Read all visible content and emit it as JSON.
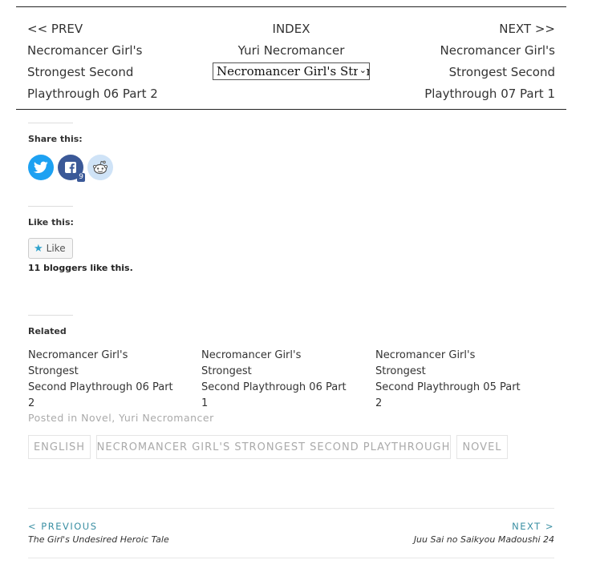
{
  "chapter_nav": {
    "prev_label": "<< PREV",
    "prev_title_lines": [
      "Necromancer Girl's",
      "Strongest Second",
      "Playthrough 06 Part 2"
    ],
    "index_label": "INDEX",
    "series_name": "Yuri Necromancer",
    "chapter_select_value": "Necromancer Girl's Strongest Second Playthrough",
    "next_label": "NEXT >>",
    "next_title_lines": [
      "Necromancer Girl's",
      "Strongest Second",
      "Playthrough 07 Part 1"
    ]
  },
  "share": {
    "title": "Share this:",
    "buttons": [
      {
        "name": "twitter",
        "icon": "twitter-icon",
        "color": "#1da1f2"
      },
      {
        "name": "facebook",
        "icon": "facebook-icon",
        "color": "#3b5998",
        "count": "9"
      },
      {
        "name": "reddit",
        "icon": "reddit-icon",
        "color": "#cfe3f7"
      }
    ]
  },
  "likes": {
    "title": "Like this:",
    "button_label": "Like",
    "count_text": "11 bloggers like this."
  },
  "related": {
    "title": "Related",
    "items": [
      {
        "line1": "Necromancer Girl's Strongest",
        "line2": "Second Playthrough 06 Part 2"
      },
      {
        "line1": "Necromancer Girl's Strongest",
        "line2": "Second Playthrough 06 Part 1"
      },
      {
        "line1": "Necromancer Girl's Strongest",
        "line2": "Second Playthrough 05 Part 2"
      }
    ]
  },
  "posted": {
    "prefix": "Posted in",
    "categories": [
      "Novel",
      "Yuri Necromancer"
    ]
  },
  "tags": [
    "ENGLISH",
    "NECROMANCER GIRL'S STRONGEST SECOND PLAYTHROUGH",
    "NOVEL"
  ],
  "post_nav": {
    "previous_label": "< PREVIOUS",
    "previous_title": "The Girl's Undesired Heroic Tale",
    "next_label": "NEXT >",
    "next_title": "Juu Sai no Saikyou Madoushi 24"
  }
}
